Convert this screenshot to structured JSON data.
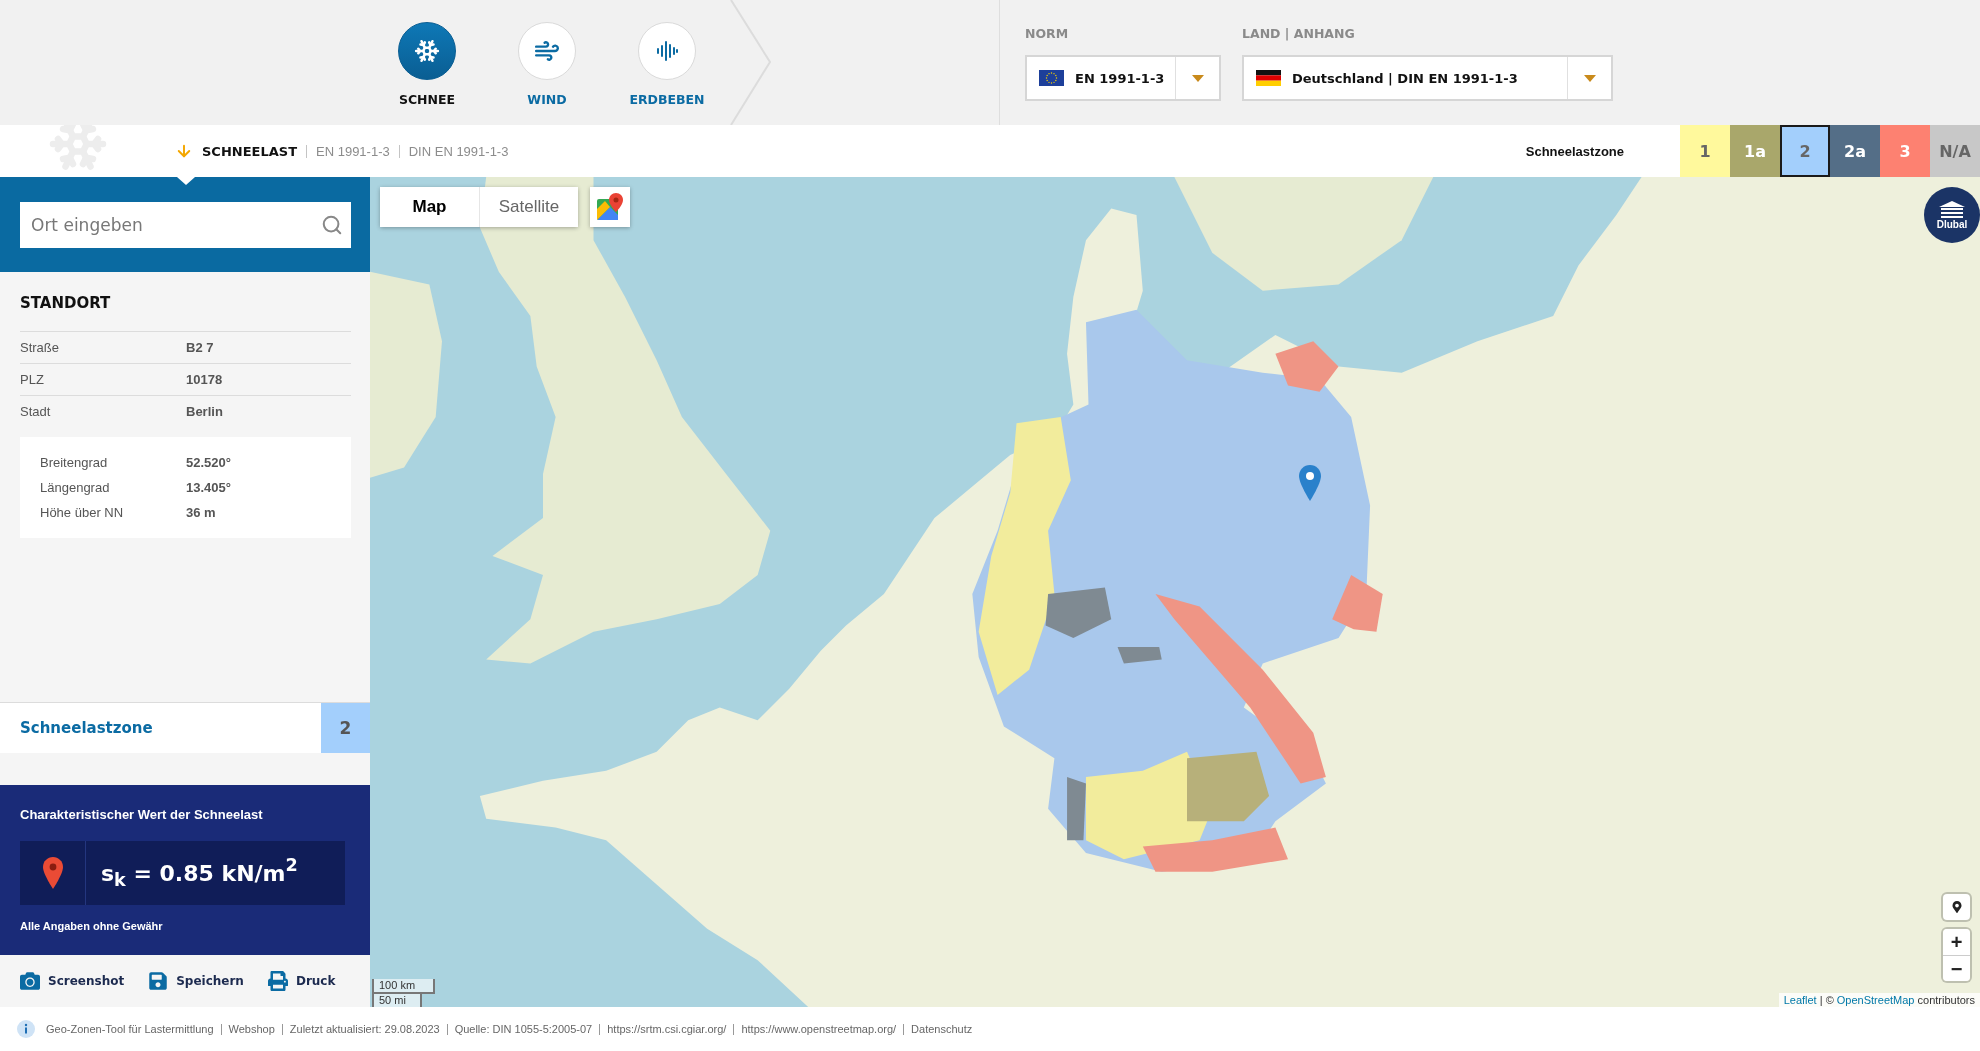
{
  "header": {
    "load_types": [
      {
        "label": "SCHNEE",
        "kind": "snow",
        "selected": true
      },
      {
        "label": "WIND",
        "kind": "wind",
        "selected": false
      },
      {
        "label": "ERDBEBEN",
        "kind": "quake",
        "selected": false
      }
    ],
    "selectors": [
      {
        "label": "NORM",
        "value": "EN 1991-1-3",
        "kind": "eu"
      },
      {
        "label": "LAND | ANHANG",
        "value": "Deutschland | DIN EN 1991-1-3",
        "kind": "de"
      }
    ]
  },
  "subheader": {
    "breadcrumb": [
      "SCHNEELAST",
      "EN 1991-1-3",
      "DIN EN 1991-1-3"
    ],
    "legend": {
      "label": "Schneelastzone",
      "zones": [
        {
          "label": "1",
          "color": "#fff99c",
          "selected": false
        },
        {
          "label": "1a",
          "color": "#a9a76b",
          "selected": false
        },
        {
          "label": "2",
          "color": "#a3cffc",
          "selected": true
        },
        {
          "label": "2a",
          "color": "#546e87",
          "selected": false
        },
        {
          "label": "3",
          "color": "#fd8171",
          "selected": false
        },
        {
          "label": "N/A",
          "color": "#c8c8c8",
          "selected": false
        }
      ]
    }
  },
  "sidebar": {
    "search": {
      "placeholder": "Ort eingeben"
    },
    "location": {
      "title": "STANDORT",
      "address": [
        {
          "label": "Straße",
          "value": "B2 7"
        },
        {
          "label": "PLZ",
          "value": "10178"
        },
        {
          "label": "Stadt",
          "value": "Berlin"
        }
      ],
      "coordinates": [
        {
          "label": "Breitengrad",
          "value": "52.520°"
        },
        {
          "label": "Längengrad",
          "value": "13.405°"
        },
        {
          "label": "Höhe über NN",
          "value": "36 m"
        }
      ]
    },
    "zone": {
      "label": "Schneelastzone",
      "value": "2"
    },
    "result": {
      "title": "Charakteristischer Wert der Schneelast",
      "formula": "s$_{k}$ = 0.85 kN/m$^{2}$",
      "disclaimer": "Alle Angaben ohne Gewähr"
    },
    "actions": [
      {
        "label": "Screenshot",
        "kind": "camera"
      },
      {
        "label": "Speichern",
        "kind": "save"
      },
      {
        "label": "Druck",
        "kind": "print"
      }
    ]
  },
  "map": {
    "tabs": [
      {
        "label": "Map",
        "selected": true
      },
      {
        "label": "Satellite",
        "selected": false
      }
    ],
    "logo": "Dlubal",
    "zoom": [
      "+",
      "−"
    ],
    "scale": [
      "100 km",
      "50 mi"
    ],
    "attribution": {
      "link": "Leaflet",
      "text": "| ©",
      "source": "OpenStreetMap",
      "suffix": "contributors"
    }
  },
  "footer": [
    "Geo-Zonen-Tool für Lastermittlung",
    "Webshop",
    "Zuletzt aktualisiert: 29.08.2023",
    "Quelle: DIN 1055-5:2005-07",
    "https://srtm.csi.cgiar.org/",
    "https://www.openstreetmap.org/",
    "Datenschutz"
  ]
}
